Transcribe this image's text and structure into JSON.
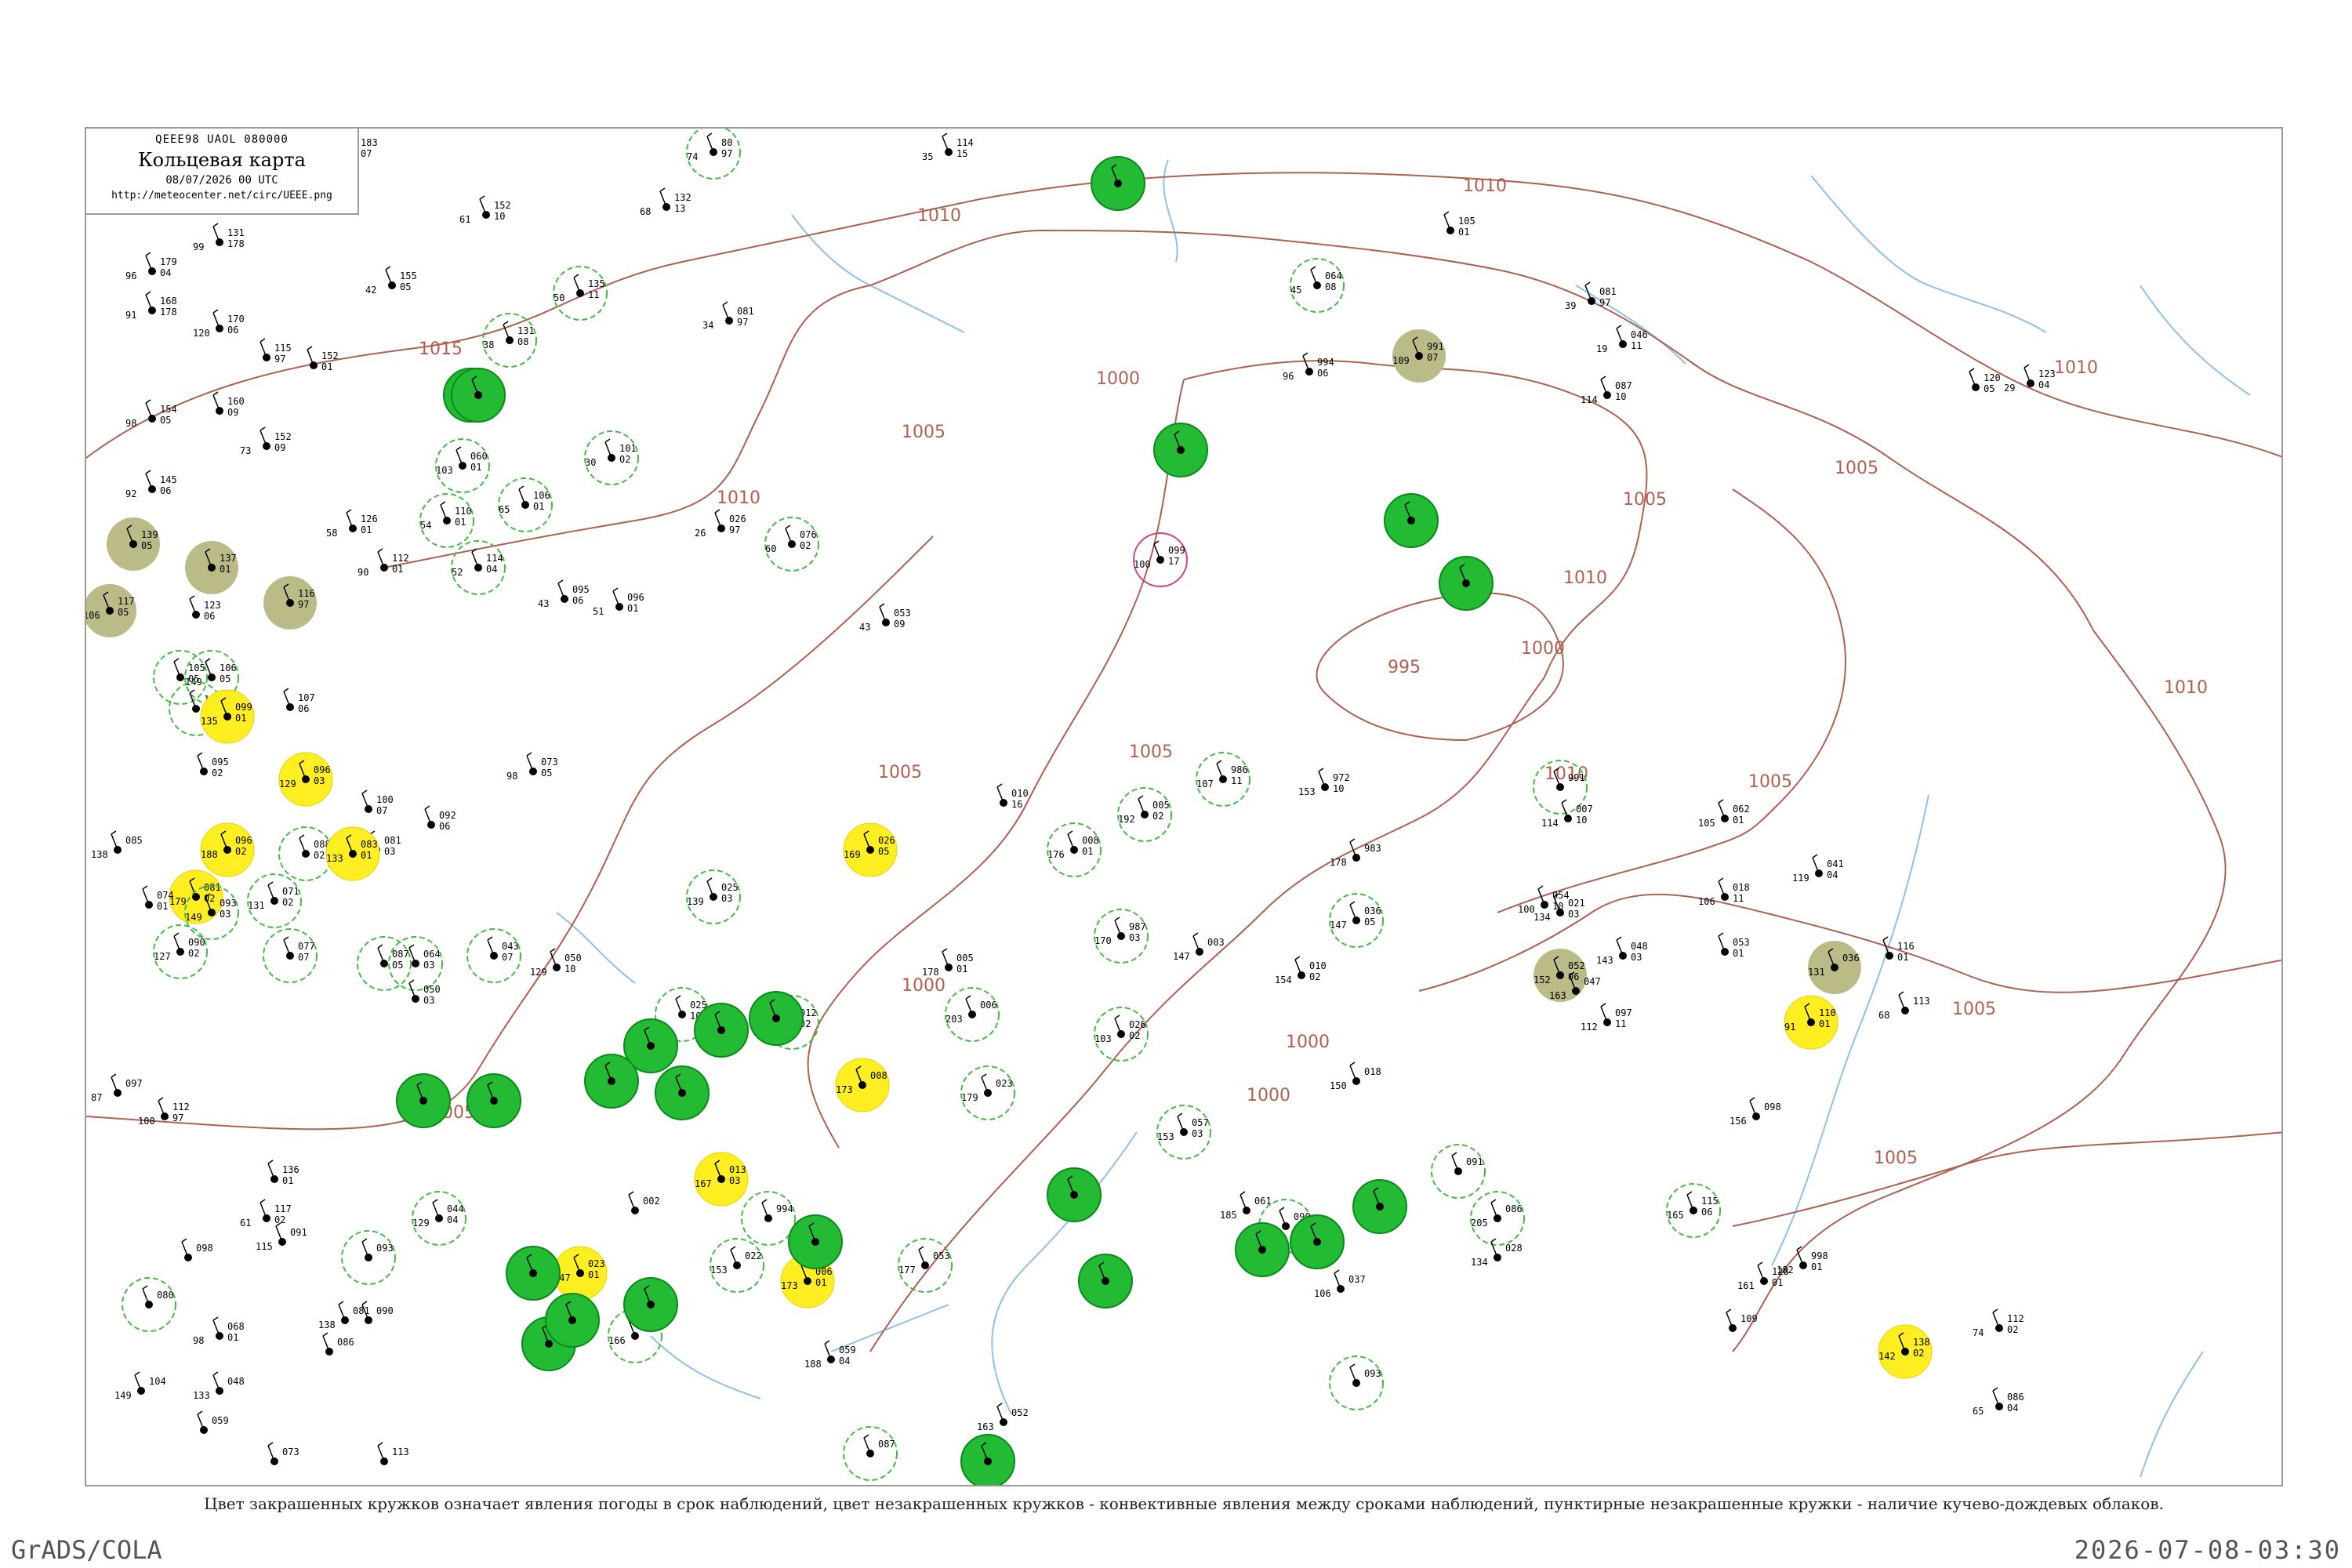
{
  "header": {
    "code_line": "QEEE98  UAOL  080000",
    "title": "Кольцевая карта",
    "datetime": "08/07/2026 00 UTC",
    "url": "http://meteocenter.net/circ/UEEE.png"
  },
  "caption": "Цвет закрашенных кружков означает явления погоды в срок наблюдений, цвет незакрашенных кружков - конвективные явления между сроками наблюдений, пунктирные незакрашенные кружки - наличие кучево-дождевых облаков.",
  "footer": {
    "left": "GrADS/COLA",
    "right": "2026-07-08-03:30"
  },
  "colors": {
    "isobar": "#b06050",
    "river": "#8fc0e8",
    "frame": "#9a9a9a",
    "rain": "#22bb33",
    "rain_border": "#0a8a1a",
    "thunder": "#ffee22",
    "fog": "#bbbb88",
    "ring_green": "#44bb44",
    "ring_magenta": "#cc4488"
  },
  "isobars": [
    {
      "label": "1015"
    },
    {
      "label": "1010"
    },
    {
      "label": "1010"
    },
    {
      "label": "1010"
    },
    {
      "label": "1005"
    },
    {
      "label": "1005"
    },
    {
      "label": "1005"
    },
    {
      "label": "1005"
    },
    {
      "label": "1000"
    },
    {
      "label": "1000"
    },
    {
      "label": "1000"
    },
    {
      "label": "1000"
    },
    {
      "label": "995"
    },
    {
      "label": "1010"
    },
    {
      "label": "1010"
    },
    {
      "label": "1005"
    },
    {
      "label": "1005"
    },
    {
      "label": "1005"
    },
    {
      "label": "1000"
    },
    {
      "label": "1005"
    },
    {
      "label": "1010"
    },
    {
      "label": "1005"
    },
    {
      "label": "1010"
    }
  ],
  "stations": [
    {
      "t": "183",
      "td": "07",
      "p": "",
      "c": "none"
    },
    {
      "t": "80",
      "td": "97",
      "p": "74",
      "c": "ring"
    },
    {
      "t": "114",
      "td": "15",
      "p": "35",
      "c": "none"
    },
    {
      "t": "152",
      "td": "10",
      "p": "61",
      "c": "none"
    },
    {
      "t": "132",
      "td": "13",
      "p": "68",
      "c": "none"
    },
    {
      "t": "179",
      "td": "04",
      "p": "96",
      "c": "none"
    },
    {
      "t": "131",
      "td": "178",
      "p": "99",
      "c": "none"
    },
    {
      "t": "155",
      "td": "05",
      "p": "42",
      "c": "none"
    },
    {
      "t": "135",
      "td": "11",
      "p": "50",
      "c": "ring"
    },
    {
      "t": "168",
      "td": "178",
      "p": "91",
      "c": "none"
    },
    {
      "t": "170",
      "td": "06",
      "p": "120",
      "c": "none"
    },
    {
      "t": "131",
      "td": "08",
      "p": "38",
      "c": "ring"
    },
    {
      "t": "115",
      "td": "97",
      "p": "",
      "c": "none"
    },
    {
      "t": "152",
      "td": "01",
      "p": "",
      "c": "none"
    },
    {
      "t": "139",
      "td": "97",
      "p": "",
      "c": "rain"
    },
    {
      "t": "154",
      "td": "05",
      "p": "98",
      "c": "none"
    },
    {
      "t": "160",
      "td": "09",
      "p": "",
      "c": "none"
    },
    {
      "t": "152",
      "td": "09",
      "p": "73",
      "c": "none"
    },
    {
      "t": "060",
      "td": "01",
      "p": "103",
      "c": "ring"
    },
    {
      "t": "101",
      "td": "02",
      "p": "30",
      "c": "ring"
    },
    {
      "t": "081",
      "td": "97",
      "p": "34",
      "c": "none"
    },
    {
      "t": "145",
      "td": "06",
      "p": "92",
      "c": "none"
    },
    {
      "t": "106",
      "td": "01",
      "p": "65",
      "c": "ring"
    },
    {
      "t": "126",
      "td": "01",
      "p": "58",
      "c": "none"
    },
    {
      "t": "112",
      "td": "01",
      "p": "90",
      "c": "none"
    },
    {
      "t": "110",
      "td": "01",
      "p": "54",
      "c": "ring"
    },
    {
      "t": "114",
      "td": "04",
      "p": "52",
      "c": "ring"
    },
    {
      "t": "026",
      "td": "97",
      "p": "26",
      "c": "none"
    },
    {
      "t": "076",
      "td": "02",
      "p": "60",
      "c": "ring"
    },
    {
      "t": "099",
      "td": "17",
      "p": "100",
      "c": "ring_magenta"
    },
    {
      "t": "095",
      "td": "06",
      "p": "43",
      "c": "none"
    },
    {
      "t": "096",
      "td": "01",
      "p": "51",
      "c": "none"
    },
    {
      "t": "053",
      "td": "09",
      "p": "43",
      "c": "none"
    },
    {
      "t": "139",
      "td": "05",
      "p": "",
      "c": "fog"
    },
    {
      "t": "137",
      "td": "01",
      "p": "",
      "c": "fog"
    },
    {
      "t": "116",
      "td": "97",
      "p": "",
      "c": "fog"
    },
    {
      "t": "117",
      "td": "05",
      "p": "106",
      "c": "fog"
    },
    {
      "t": "123",
      "td": "06",
      "p": "",
      "c": "none"
    },
    {
      "t": "064",
      "td": "08",
      "p": "45",
      "c": "ring"
    },
    {
      "t": "994",
      "td": "06",
      "p": "96",
      "c": "none"
    },
    {
      "t": "991",
      "td": "07",
      "p": "109",
      "c": "fog"
    },
    {
      "t": "105",
      "td": "01",
      "p": "",
      "c": "none"
    },
    {
      "t": "081",
      "td": "97",
      "p": "39",
      "c": "none"
    },
    {
      "t": "087",
      "td": "10",
      "p": "114",
      "c": "none"
    },
    {
      "t": "046",
      "td": "11",
      "p": "19",
      "c": "none"
    },
    {
      "t": "123",
      "td": "04",
      "p": "29",
      "c": "none"
    },
    {
      "t": "120",
      "td": "05",
      "p": "",
      "c": "none"
    },
    {
      "t": "105",
      "td": "05",
      "p": "",
      "c": "ring"
    },
    {
      "t": "106",
      "td": "05",
      "p": "149",
      "c": "ring"
    },
    {
      "t": "108",
      "td": "05",
      "p": "",
      "c": "ring"
    },
    {
      "t": "099",
      "td": "01",
      "p": "135",
      "c": "thunder"
    },
    {
      "t": "107",
      "td": "06",
      "p": "",
      "c": "none"
    },
    {
      "t": "095",
      "td": "02",
      "p": "",
      "c": "none"
    },
    {
      "t": "096",
      "td": "03",
      "p": "129",
      "c": "thunder"
    },
    {
      "t": "100",
      "td": "07",
      "p": "",
      "c": "none"
    },
    {
      "t": "092",
      "td": "06",
      "p": "",
      "c": "none"
    },
    {
      "t": "073",
      "td": "05",
      "p": "98",
      "c": "none"
    },
    {
      "t": "088",
      "td": "02",
      "p": "",
      "c": "ring"
    },
    {
      "t": "081",
      "td": "03",
      "p": "",
      "c": "none"
    },
    {
      "t": "083",
      "td": "01",
      "p": "133",
      "c": "thunder"
    },
    {
      "t": "096",
      "td": "02",
      "p": "188",
      "c": "thunder"
    },
    {
      "t": "081",
      "td": "02",
      "p": "179",
      "c": "thunder"
    },
    {
      "t": "093",
      "td": "03",
      "p": "149",
      "c": "ring"
    },
    {
      "t": "074",
      "td": "01",
      "p": "",
      "c": "none"
    },
    {
      "t": "085",
      "td": "",
      "p": "138",
      "c": "none"
    },
    {
      "t": "071",
      "td": "02",
      "p": "131",
      "c": "ring"
    },
    {
      "t": "090",
      "td": "02",
      "p": "127",
      "c": "ring"
    },
    {
      "t": "077",
      "td": "07",
      "p": "",
      "c": "ring"
    },
    {
      "t": "087",
      "td": "05",
      "p": "",
      "c": "ring"
    },
    {
      "t": "064",
      "td": "03",
      "p": "",
      "c": "ring"
    },
    {
      "t": "050",
      "td": "03",
      "p": "",
      "c": "none"
    },
    {
      "t": "043",
      "td": "07",
      "p": "",
      "c": "ring"
    },
    {
      "t": "050",
      "td": "10",
      "p": "129",
      "c": "none"
    },
    {
      "t": "112",
      "td": "97",
      "p": "100",
      "c": "none"
    },
    {
      "t": "097",
      "td": "",
      "p": "87",
      "c": "none"
    },
    {
      "t": "025",
      "td": "03",
      "p": "139",
      "c": "ring"
    },
    {
      "t": "026",
      "td": "05",
      "p": "169",
      "c": "thunder"
    },
    {
      "t": "010",
      "td": "16",
      "p": "",
      "c": "none"
    },
    {
      "t": "008",
      "td": "01",
      "p": "176",
      "c": "ring"
    },
    {
      "t": "005",
      "td": "02",
      "p": "192",
      "c": "ring"
    },
    {
      "t": "986",
      "td": "11",
      "p": "107",
      "c": "ring"
    },
    {
      "t": "972",
      "td": "10",
      "p": "153",
      "c": "none"
    },
    {
      "t": "983",
      "td": "",
      "p": "178",
      "c": "none"
    },
    {
      "t": "991",
      "td": "",
      "p": "",
      "c": "ring"
    },
    {
      "t": "007",
      "td": "10",
      "p": "114",
      "c": "none"
    },
    {
      "t": "054",
      "td": "10",
      "p": "100",
      "c": "none"
    },
    {
      "t": "018",
      "td": "11",
      "p": "106",
      "c": "none"
    },
    {
      "t": "062",
      "td": "01",
      "p": "105",
      "c": "none"
    },
    {
      "t": "041",
      "td": "04",
      "p": "119",
      "c": "none"
    },
    {
      "t": "036",
      "td": "",
      "p": "131",
      "c": "fog"
    },
    {
      "t": "053",
      "td": "01",
      "p": "",
      "c": "none"
    },
    {
      "t": "021",
      "td": "03",
      "p": "134",
      "c": "none"
    },
    {
      "t": "052",
      "td": "06",
      "p": "152",
      "c": "fog"
    },
    {
      "t": "036",
      "td": "05",
      "p": "147",
      "c": "ring"
    },
    {
      "t": "048",
      "td": "03",
      "p": "143",
      "c": "none"
    },
    {
      "t": "047",
      "td": "",
      "p": "163",
      "c": "none"
    },
    {
      "t": "097",
      "td": "11",
      "p": "112",
      "c": "none"
    },
    {
      "t": "116",
      "td": "01",
      "p": "",
      "c": "none"
    },
    {
      "t": "113",
      "td": "",
      "p": "68",
      "c": "none"
    },
    {
      "t": "110",
      "td": "01",
      "p": "91",
      "c": "thunder"
    },
    {
      "t": "098",
      "td": "",
      "p": "156",
      "c": "none"
    },
    {
      "t": "998",
      "td": "01",
      "p": "182",
      "c": "none"
    },
    {
      "t": "987",
      "td": "03",
      "p": "170",
      "c": "ring"
    },
    {
      "t": "003",
      "td": "",
      "p": "147",
      "c": "none"
    },
    {
      "t": "010",
      "td": "02",
      "p": "154",
      "c": "none"
    },
    {
      "t": "005",
      "td": "01",
      "p": "178",
      "c": "none"
    },
    {
      "t": "006",
      "td": "",
      "p": "203",
      "c": "ring"
    },
    {
      "t": "025",
      "td": "10",
      "p": "",
      "c": "ring"
    },
    {
      "t": "012",
      "td": "02",
      "p": "150",
      "c": "ring"
    },
    {
      "t": "026",
      "td": "02",
      "p": "103",
      "c": "ring"
    },
    {
      "t": "008",
      "td": "",
      "p": "173",
      "c": "thunder"
    },
    {
      "t": "023",
      "td": "",
      "p": "179",
      "c": "ring"
    },
    {
      "t": "018",
      "td": "",
      "p": "150",
      "c": "none"
    },
    {
      "t": "002",
      "td": "",
      "p": "",
      "c": "none"
    },
    {
      "t": "013",
      "td": "03",
      "p": "167",
      "c": "thunder"
    },
    {
      "t": "023",
      "td": "01",
      "p": "347",
      "c": "thunder"
    },
    {
      "t": "002",
      "td": "",
      "p": "166",
      "c": "ring"
    },
    {
      "t": "994",
      "td": "",
      "p": "",
      "c": "ring"
    },
    {
      "t": "006",
      "td": "01",
      "p": "173",
      "c": "thunder"
    },
    {
      "t": "022",
      "td": "",
      "p": "153",
      "c": "ring"
    },
    {
      "t": "059",
      "td": "04",
      "p": "188",
      "c": "none"
    },
    {
      "t": "057",
      "td": "03",
      "p": "153",
      "c": "ring"
    },
    {
      "t": "053",
      "td": "",
      "p": "177",
      "c": "ring"
    },
    {
      "t": "052",
      "td": "",
      "p": "163",
      "c": "none"
    },
    {
      "t": "061",
      "td": "",
      "p": "185",
      "c": "none"
    },
    {
      "t": "086",
      "td": "",
      "p": "205",
      "c": "ring"
    },
    {
      "t": "090",
      "td": "",
      "p": "192",
      "c": "ring"
    },
    {
      "t": "037",
      "td": "",
      "p": "106",
      "c": "none"
    },
    {
      "t": "028",
      "td": "",
      "p": "134",
      "c": "none"
    },
    {
      "t": "091",
      "td": "",
      "p": "",
      "c": "ring"
    },
    {
      "t": "093",
      "td": "",
      "p": "",
      "c": "ring"
    },
    {
      "t": "115",
      "td": "06",
      "p": "165",
      "c": "ring"
    },
    {
      "t": "109",
      "td": "",
      "p": "",
      "c": "none"
    },
    {
      "t": "128",
      "td": "01",
      "p": "161",
      "c": "none"
    },
    {
      "t": "138",
      "td": "02",
      "p": "142",
      "c": "thunder"
    },
    {
      "t": "112",
      "td": "02",
      "p": "74",
      "c": "none"
    },
    {
      "t": "086",
      "td": "04",
      "p": "65",
      "c": "none"
    },
    {
      "t": "080",
      "td": "",
      "p": "",
      "c": "ring"
    },
    {
      "t": "068",
      "td": "01",
      "p": "98",
      "c": "none"
    },
    {
      "t": "086",
      "td": "",
      "p": "",
      "c": "none"
    },
    {
      "t": "048",
      "td": "",
      "p": "133",
      "c": "none"
    },
    {
      "t": "093",
      "td": "",
      "p": "",
      "c": "ring"
    },
    {
      "t": "081",
      "td": "",
      "p": "138",
      "c": "none"
    },
    {
      "t": "117",
      "td": "02",
      "p": "61",
      "c": "none"
    },
    {
      "t": "091",
      "td": "",
      "p": "115",
      "c": "none"
    },
    {
      "t": "098",
      "td": "",
      "p": "",
      "c": "none"
    },
    {
      "t": "104",
      "td": "",
      "p": "149",
      "c": "none"
    },
    {
      "t": "090",
      "td": "",
      "p": "",
      "c": "none"
    },
    {
      "t": "044",
      "td": "04",
      "p": "129",
      "c": "ring"
    },
    {
      "t": "136",
      "td": "01",
      "p": "",
      "c": "none"
    },
    {
      "t": "113",
      "td": "",
      "p": "",
      "c": "none"
    },
    {
      "t": "073",
      "td": "",
      "p": "",
      "c": "none"
    },
    {
      "t": "059",
      "td": "",
      "p": "",
      "c": "none"
    },
    {
      "t": "087",
      "td": "",
      "p": "",
      "c": "ring"
    },
    {
      "t": "",
      "td": "",
      "p": "",
      "c": "rain"
    },
    {
      "t": "",
      "td": "",
      "p": "",
      "c": "rain"
    },
    {
      "t": "",
      "td": "",
      "p": "",
      "c": "rain"
    },
    {
      "t": "",
      "td": "",
      "p": "",
      "c": "rain"
    },
    {
      "t": "",
      "td": "",
      "p": "",
      "c": "rain"
    },
    {
      "t": "",
      "td": "",
      "p": "",
      "c": "rain"
    },
    {
      "t": "",
      "td": "",
      "p": "",
      "c": "rain"
    },
    {
      "t": "",
      "td": "",
      "p": "",
      "c": "rain"
    },
    {
      "t": "",
      "td": "",
      "p": "",
      "c": "rain"
    },
    {
      "t": "",
      "td": "",
      "p": "",
      "c": "rain"
    },
    {
      "t": "",
      "td": "",
      "p": "",
      "c": "rain"
    },
    {
      "t": "",
      "td": "",
      "p": "",
      "c": "rain"
    },
    {
      "t": "",
      "td": "",
      "p": "",
      "c": "rain"
    },
    {
      "t": "",
      "td": "",
      "p": "",
      "c": "rain"
    },
    {
      "t": "",
      "td": "",
      "p": "",
      "c": "rain"
    },
    {
      "t": "",
      "td": "",
      "p": "",
      "c": "rain"
    },
    {
      "t": "",
      "td": "",
      "p": "",
      "c": "rain"
    },
    {
      "t": "",
      "td": "",
      "p": "",
      "c": "rain"
    },
    {
      "t": "",
      "td": "",
      "p": "",
      "c": "rain"
    },
    {
      "t": "",
      "td": "",
      "p": "",
      "c": "rain"
    },
    {
      "t": "",
      "td": "",
      "p": "",
      "c": "rain"
    },
    {
      "t": "",
      "td": "",
      "p": "",
      "c": "rain"
    },
    {
      "t": "",
      "td": "",
      "p": "",
      "c": "rain"
    },
    {
      "t": "",
      "td": "",
      "p": "",
      "c": "rain"
    },
    {
      "t": "",
      "td": "",
      "p": "",
      "c": "rain"
    },
    {
      "t": "",
      "td": "",
      "p": "",
      "c": "rain"
    }
  ]
}
